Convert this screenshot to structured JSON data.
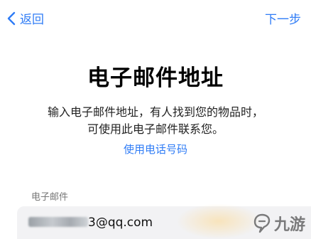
{
  "nav": {
    "back_label": "返回",
    "next_label": "下一步"
  },
  "title": "电子邮件地址",
  "description": {
    "line1": "输入电子邮件地址，有人找到您的物品时，",
    "line2": "可使用此电子邮件联系您。"
  },
  "phone_link": "使用电话号码",
  "email_field": {
    "label": "电子邮件",
    "value_suffix": "3@qq.com"
  },
  "watermark": {
    "text": "九游"
  },
  "colors": {
    "accent": "#2f7cf6",
    "field_bg": "#f2f2f4"
  }
}
